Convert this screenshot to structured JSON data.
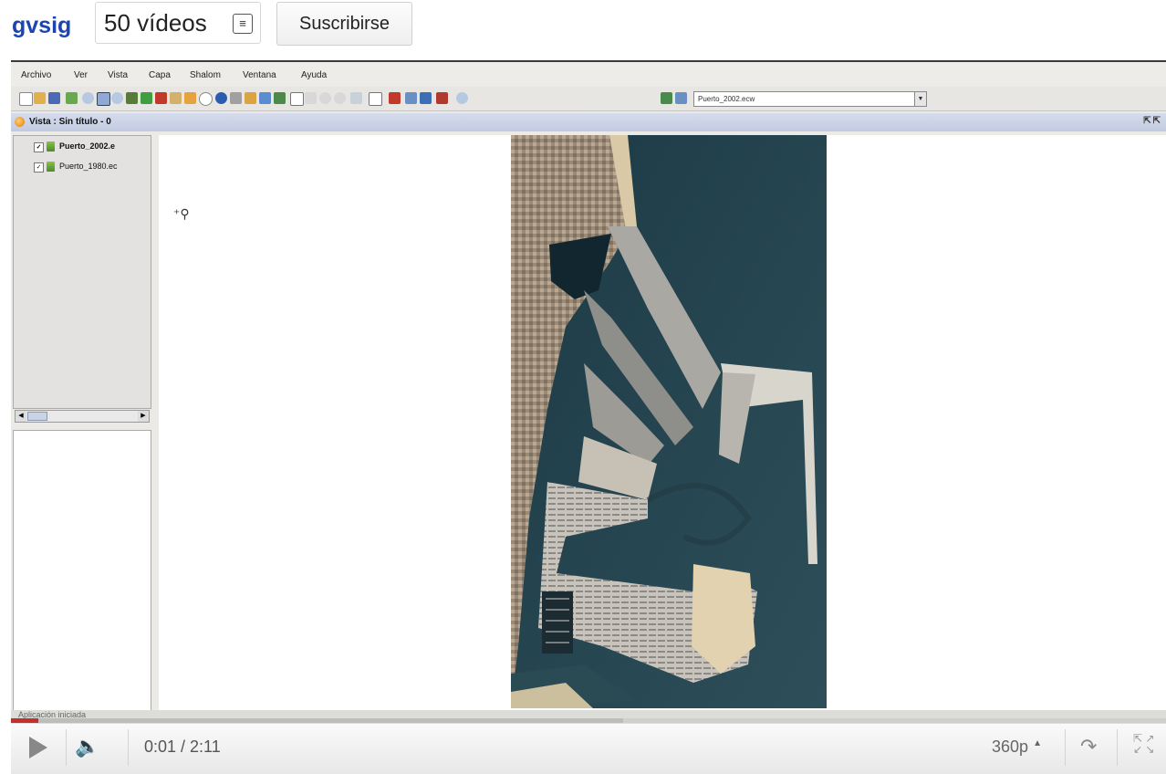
{
  "channel": {
    "name": "gvsig",
    "video_count": "50 vídeos",
    "subscribe_label": "Suscribirse"
  },
  "app": {
    "menu": [
      "Archivo",
      "Ver",
      "Vista",
      "Capa",
      "Shalom",
      "Ventana",
      "Ayuda"
    ],
    "layer_combo_value": "Puerto_2002.ecw",
    "view_title": "Vista : Sin título - 0",
    "layers": [
      {
        "name": "Puerto_2002.e",
        "checked": true,
        "active": true
      },
      {
        "name": "Puerto_1980.ec",
        "checked": true,
        "active": false
      }
    ],
    "status_message": "Aplicación iniciada"
  },
  "player": {
    "time": "0:01 / 2:11",
    "quality": "360p",
    "played_fraction": 0.024,
    "buffered_fraction": 0.53
  },
  "colors": {
    "channel_link": "#1b45b0",
    "progress_played": "#c4302b"
  }
}
